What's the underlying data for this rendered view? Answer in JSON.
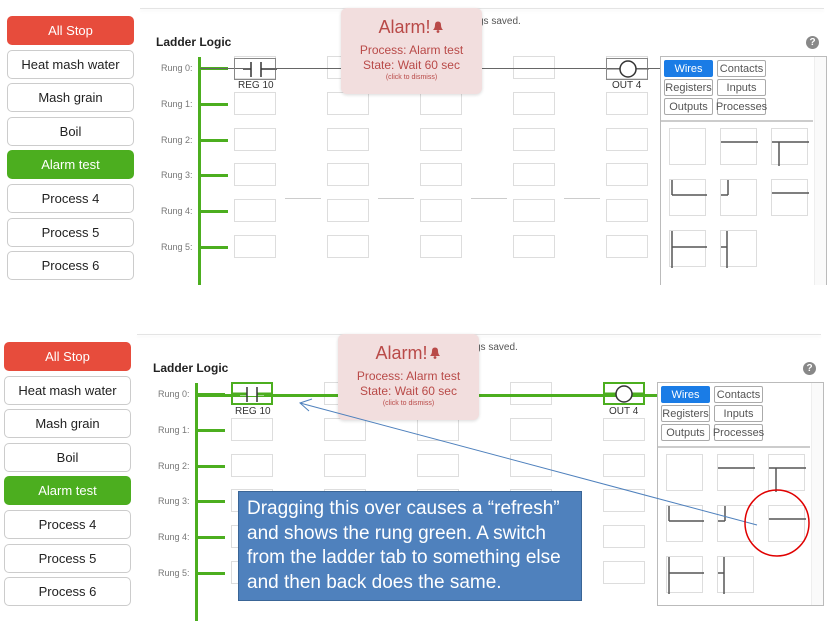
{
  "panels": [
    {
      "sidebar": [
        {
          "label": "All Stop",
          "style": "red"
        },
        {
          "label": "Heat mash water",
          "style": "default"
        },
        {
          "label": "Mash grain",
          "style": "default"
        },
        {
          "label": "Boil",
          "style": "default"
        },
        {
          "label": "Alarm test",
          "style": "green"
        },
        {
          "label": "Process 4",
          "style": "default"
        },
        {
          "label": "Process 5",
          "style": "default"
        },
        {
          "label": "Process 6",
          "style": "default"
        }
      ],
      "saved_text": "gs saved.",
      "title": "Ladder Logic",
      "help": "?",
      "rungs": [
        "Rung 0:",
        "Rung 1:",
        "Rung 2:",
        "Rung 3:",
        "Rung 4:",
        "Rung 5:"
      ],
      "rung0_active": false,
      "contact_label": "REG 10",
      "coil_label": "OUT 4",
      "alarm": {
        "title": "Alarm!",
        "process": "Process: Alarm test",
        "state": "State: Wait 60 sec",
        "dismiss": "(click to dismiss)"
      },
      "palette_tabs": [
        "Wires",
        "Contacts",
        "Registers",
        "Inputs",
        "Outputs",
        "Processes"
      ],
      "palette_selected": "Wires"
    },
    {
      "sidebar": [
        {
          "label": "All Stop",
          "style": "red"
        },
        {
          "label": "Heat mash water",
          "style": "default"
        },
        {
          "label": "Mash grain",
          "style": "default"
        },
        {
          "label": "Boil",
          "style": "default"
        },
        {
          "label": "Alarm test",
          "style": "green"
        },
        {
          "label": "Process 4",
          "style": "default"
        },
        {
          "label": "Process 5",
          "style": "default"
        },
        {
          "label": "Process 6",
          "style": "default"
        }
      ],
      "saved_text": "gs saved.",
      "title": "Ladder Logic",
      "help": "?",
      "rungs": [
        "Rung 0:",
        "Rung 1:",
        "Rung 2:",
        "Rung 3:",
        "Rung 4:",
        "Rung 5:"
      ],
      "rung0_active": true,
      "contact_label": "REG 10",
      "coil_label": "OUT 4",
      "alarm": {
        "title": "Alarm!",
        "process": "Process: Alarm test",
        "state": "State: Wait 60 sec",
        "dismiss": "(click to dismiss)"
      },
      "palette_tabs": [
        "Wires",
        "Contacts",
        "Registers",
        "Inputs",
        "Outputs",
        "Processes"
      ],
      "palette_selected": "Wires"
    }
  ],
  "annotation": {
    "text": "Dragging this over causes a “refresh” and shows the rung green. A switch from the ladder tab to something else and then back does the same."
  },
  "colors": {
    "green": "#4cae1f",
    "red": "#e74c3c",
    "accent": "#1a7ce6",
    "alarm_bg": "#f2dede",
    "alarm_text": "#b94a48",
    "annotation_bg": "#4f81bd",
    "highlight_circle": "#e00000"
  }
}
